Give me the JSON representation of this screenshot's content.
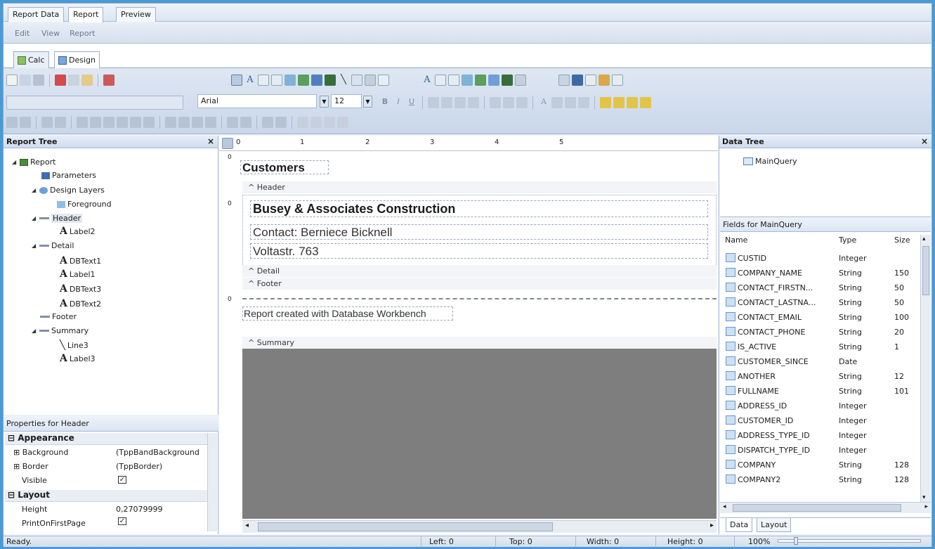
{
  "top_tabs": [
    "Report Data",
    "Report",
    "Preview"
  ],
  "menu": [
    "Edit",
    "View",
    "Report"
  ],
  "design_tabs": [
    "Calc",
    "Design"
  ],
  "toolbar": {
    "font_name": "Arial",
    "font_size": "12"
  },
  "report_tree": {
    "title": "Report Tree",
    "items": [
      "Report",
      "Parameters",
      "Design Layers",
      "Foreground",
      "Header",
      "Label2",
      "Detail",
      "DBText1",
      "Label1",
      "DBText3",
      "DBText2",
      "Footer",
      "Summary",
      "Line3",
      "Label3"
    ]
  },
  "properties": {
    "title": "Properties for Header",
    "appearance": "Appearance",
    "background_label": "Background",
    "background_value": "(TppBandBackground",
    "border_label": "Border",
    "border_value": "(TppBorder)",
    "visible_label": "Visible",
    "layout": "Layout",
    "height_label": "Height",
    "height_value": "0,27079999",
    "printfirst_label": "PrintOnFirstPage"
  },
  "design": {
    "ruler_numbers": [
      "0",
      "1",
      "2",
      "3",
      "4",
      "5"
    ],
    "title": "Customers",
    "header_band": "^ Header",
    "company": "Busey & Associates Construction",
    "contact": "Contact: Berniece Bicknell",
    "street": "Voltastr. 763",
    "detail_band": "^ Detail",
    "footer_band": "^ Footer",
    "footer_text": "Report created with Database Workbench",
    "summary_band": "^ Summary",
    "zero_marks": [
      "0",
      "0",
      "0"
    ]
  },
  "data_tree": {
    "title": "Data Tree",
    "query": "MainQuery",
    "fields_title": "Fields for MainQuery",
    "columns": [
      "Name",
      "Type",
      "Size"
    ],
    "fields": [
      {
        "name": "CUSTID",
        "type": "Integer",
        "size": ""
      },
      {
        "name": "COMPANY_NAME",
        "type": "String",
        "size": "150"
      },
      {
        "name": "CONTACT_FIRSTN...",
        "type": "String",
        "size": "50"
      },
      {
        "name": "CONTACT_LASTNA...",
        "type": "String",
        "size": "50"
      },
      {
        "name": "CONTACT_EMAIL",
        "type": "String",
        "size": "100"
      },
      {
        "name": "CONTACT_PHONE",
        "type": "String",
        "size": "20"
      },
      {
        "name": "IS_ACTIVE",
        "type": "String",
        "size": "1"
      },
      {
        "name": "CUSTOMER_SINCE",
        "type": "Date",
        "size": ""
      },
      {
        "name": "ANOTHER",
        "type": "String",
        "size": "12"
      },
      {
        "name": "FULLNAME",
        "type": "String",
        "size": "101"
      },
      {
        "name": "ADDRESS_ID",
        "type": "Integer",
        "size": ""
      },
      {
        "name": "CUSTOMER_ID",
        "type": "Integer",
        "size": ""
      },
      {
        "name": "ADDRESS_TYPE_ID",
        "type": "Integer",
        "size": ""
      },
      {
        "name": "DISPATCH_TYPE_ID",
        "type": "Integer",
        "size": ""
      },
      {
        "name": "COMPANY",
        "type": "String",
        "size": "128"
      },
      {
        "name": "COMPANY2",
        "type": "String",
        "size": "128"
      }
    ],
    "bottom_tabs": [
      "Data",
      "Layout"
    ]
  },
  "status": {
    "text": "Ready.",
    "left": "Left: 0",
    "top": "Top: 0",
    "width": "Width: 0",
    "height": "Height: 0",
    "zoom": "100%"
  },
  "colors": {
    "accent": "#4a9ad4",
    "summary_fill": "#7e7e7e"
  }
}
